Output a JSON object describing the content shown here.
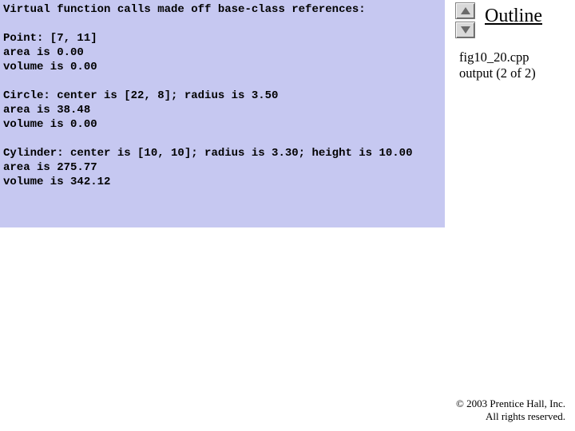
{
  "sidebar": {
    "outline_title": "Outline",
    "file_label": "fig10_20.cpp\noutput (2 of 2)"
  },
  "output": {
    "header": "Virtual function calls made off base-class references:",
    "blocks": [
      {
        "line1": "Point: [7, 11]",
        "line2": "area is 0.00",
        "line3": "volume is 0.00"
      },
      {
        "line1": "Circle: center is [22, 8]; radius is 3.50",
        "line2": "area is 38.48",
        "line3": "volume is 0.00"
      },
      {
        "line1": "Cylinder: center is [10, 10]; radius is 3.30; height is 10.00",
        "line2": "area is 275.77",
        "line3": "volume is 342.12"
      }
    ]
  },
  "footer": {
    "copyright": "© 2003 Prentice Hall, Inc.",
    "rights": "All rights reserved."
  }
}
